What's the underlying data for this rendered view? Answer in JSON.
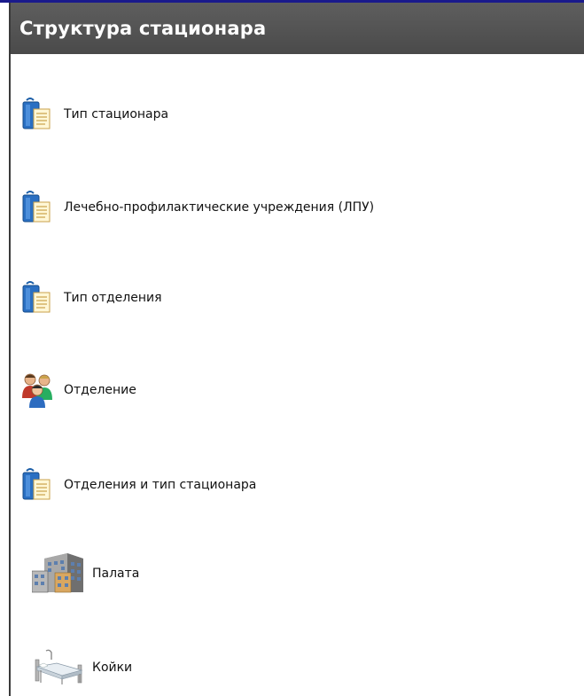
{
  "panel": {
    "title": "Структура стационара"
  },
  "items": [
    {
      "label": "Тип стационара",
      "icon": "document-folder-icon"
    },
    {
      "label": "Лечебно-профилактические учреждения (ЛПУ)",
      "icon": "document-folder-icon"
    },
    {
      "label": "Тип отделения",
      "icon": "document-folder-icon"
    },
    {
      "label": "Отделение",
      "icon": "people-group-icon"
    },
    {
      "label": "Отделения и тип стационара",
      "icon": "document-folder-icon"
    },
    {
      "label": "Палата",
      "icon": "building-icon"
    },
    {
      "label": "Койки",
      "icon": "bed-icon"
    }
  ],
  "colors": {
    "header_bg": "#4a4a4a",
    "header_text": "#ffffff",
    "accent": "#1a1a8c"
  }
}
